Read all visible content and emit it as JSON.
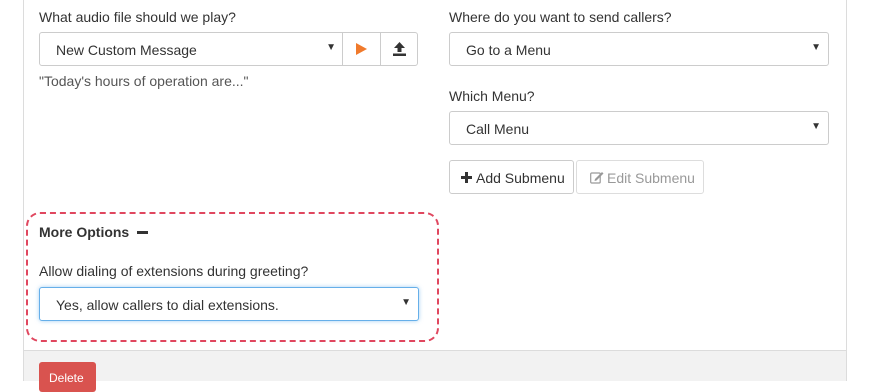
{
  "audio": {
    "question": "What audio file should we play?",
    "selected": "New Custom Message",
    "preview_text": "\"Today's hours of operation are...\"",
    "play_icon": "play-icon",
    "upload_icon": "upload-icon"
  },
  "destination": {
    "question": "Where do you want to send callers?",
    "selected": "Go to a Menu"
  },
  "menu": {
    "question": "Which Menu?",
    "selected": "Call Menu",
    "add_submenu_label": "Add Submenu",
    "edit_submenu_label": "Edit Submenu"
  },
  "more_options": {
    "title": "More Options",
    "question": "Allow dialing of extensions during greeting?",
    "selected": "Yes, allow callers to dial extensions."
  },
  "footer": {
    "delete_label": "Delete"
  },
  "colors": {
    "accent_play": "#f07a2c",
    "highlight_outline": "#e0475f",
    "delete": "#d9534f",
    "focus": "#66afe9"
  }
}
